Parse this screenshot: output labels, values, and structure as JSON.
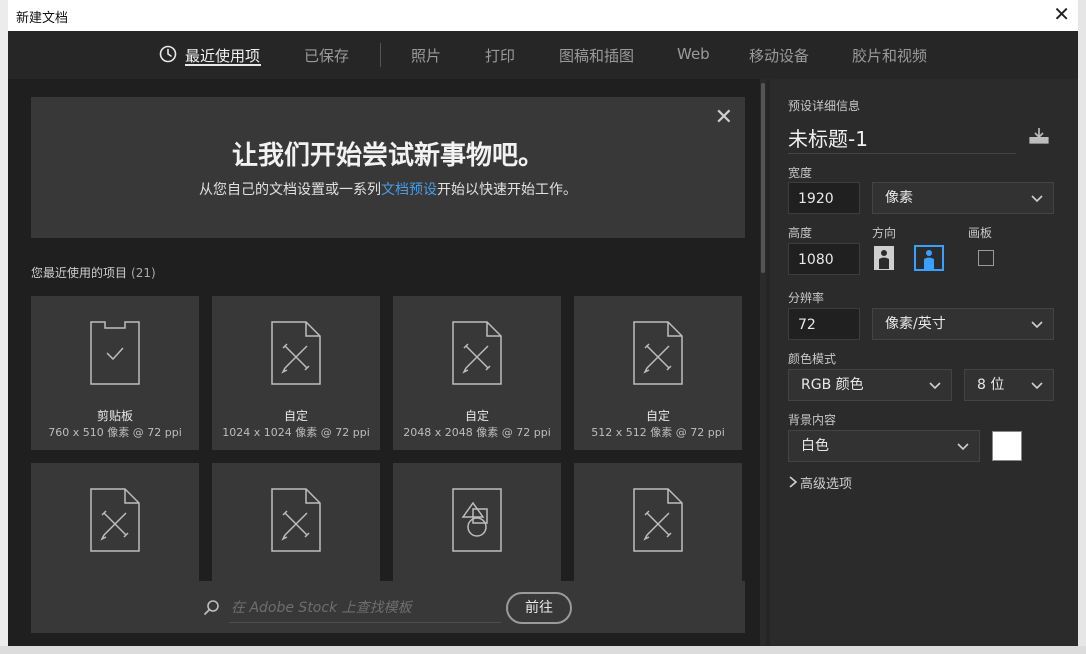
{
  "dialog": {
    "title": "新建文档",
    "close_glyph": "✕"
  },
  "tabs": [
    {
      "label": "最近使用项",
      "active": true
    },
    {
      "label": "已保存"
    },
    {
      "label": "照片"
    },
    {
      "label": "打印"
    },
    {
      "label": "图稿和插图"
    },
    {
      "label": "Web"
    },
    {
      "label": "移动设备"
    },
    {
      "label": "胶片和视频"
    }
  ],
  "hero": {
    "heading": "让我们开始尝试新事物吧。",
    "sub_prefix": "从您自己的文档设置或一系列",
    "sub_link": "文档预设",
    "sub_suffix": "开始以快速开始工作。",
    "close_glyph": "✕"
  },
  "recent": {
    "label": "您最近使用的项目",
    "count": "(21)",
    "items": [
      {
        "name": "剪贴板",
        "meta": "760 x 510 像素 @ 72 ppi",
        "icon": "clipboard-icon"
      },
      {
        "name": "自定",
        "meta": "1024 x 1024 像素 @ 72 ppi",
        "icon": "custom-doc-icon"
      },
      {
        "name": "自定",
        "meta": "2048 x 2048 像素 @ 72 ppi",
        "icon": "custom-doc-icon"
      },
      {
        "name": "自定",
        "meta": "512 x 512 像素 @ 72 ppi",
        "icon": "custom-doc-icon"
      },
      {
        "name": "",
        "meta": "",
        "icon": "custom-doc-icon"
      },
      {
        "name": "",
        "meta": "",
        "icon": "custom-doc-icon"
      },
      {
        "name": "",
        "meta": "",
        "icon": "shapes-doc-icon"
      },
      {
        "name": "",
        "meta": "",
        "icon": "custom-doc-icon"
      }
    ]
  },
  "search": {
    "placeholder": "在 Adobe Stock 上查找模板",
    "go_label": "前往"
  },
  "preset": {
    "section_label": "预设详细信息",
    "doc_name": "未标题-1",
    "width_label": "宽度",
    "width_value": "1920",
    "width_unit": "像素",
    "height_label": "高度",
    "height_value": "1080",
    "orientation_label": "方向",
    "artboard_label": "画板",
    "resolution_label": "分辨率",
    "resolution_value": "72",
    "resolution_unit": "像素/英寸",
    "color_mode_label": "颜色模式",
    "color_mode": "RGB 颜色",
    "bit_depth": "8 位",
    "background_label": "背景内容",
    "background": "白色",
    "advanced_label": "高级选项"
  }
}
